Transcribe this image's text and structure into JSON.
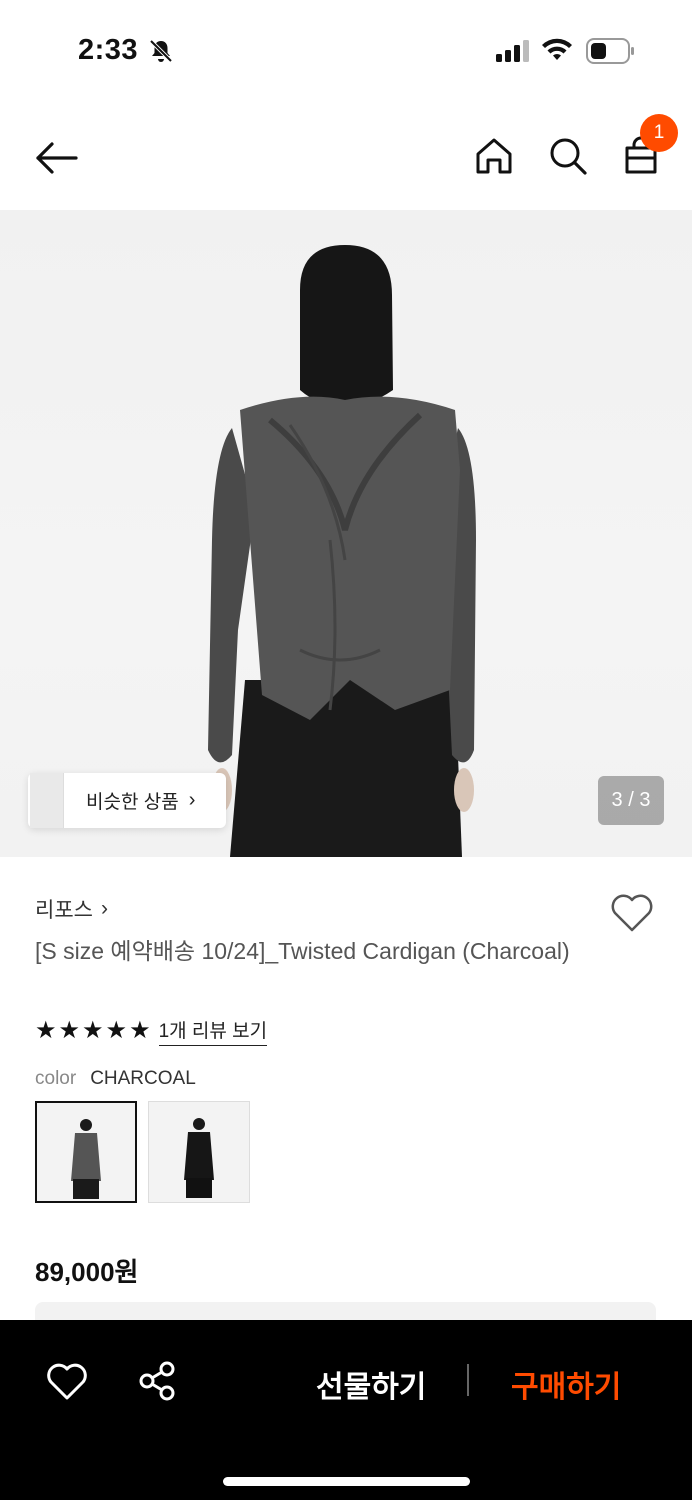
{
  "status_bar": {
    "time": "2:33",
    "icons": [
      "bell-slash-icon",
      "signal-icon",
      "wifi-icon",
      "battery-icon"
    ]
  },
  "header": {
    "cart_count": "1",
    "icons": [
      "back-arrow-icon",
      "home-icon",
      "search-icon",
      "shopping-bag-icon"
    ]
  },
  "gallery": {
    "similar_label": "비슷한 상품",
    "similar_chevron": "›",
    "counter": "3 / 3"
  },
  "product": {
    "brand": "리포스",
    "brand_chevron": "›",
    "title": "[S size 예약배송 10/24]_Twisted Cardigan (Charcoal)",
    "rating_stars": 5,
    "review_link": "1개 리뷰 보기",
    "color_label": "color",
    "color_value": "CHARCOAL",
    "price": "89,000원"
  },
  "bottom_bar": {
    "gift_label": "선물하기",
    "buy_label": "구매하기"
  },
  "colors": {
    "accent": "#ff4b00",
    "bottom_bar_bg": "#000000"
  }
}
